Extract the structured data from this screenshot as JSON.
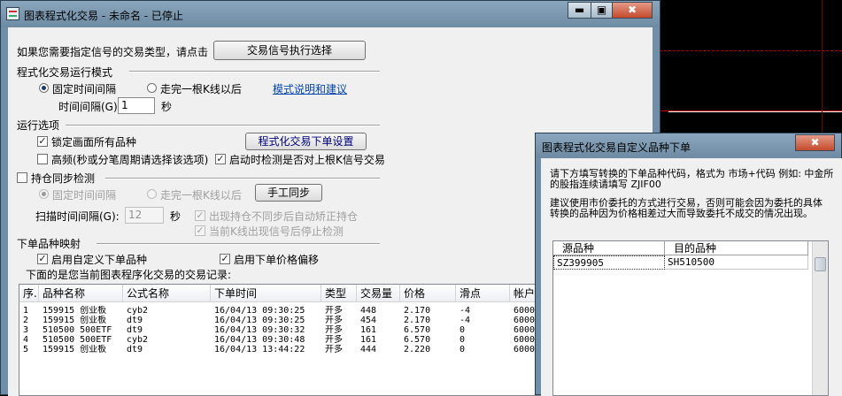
{
  "colors": {
    "title_bg": "#7591a9",
    "accent_red": "#c00000",
    "link": "#0645ad"
  },
  "main": {
    "title": "图表程式化交易 - 未命名 - 已停止",
    "title_buttons": [
      "▬",
      "▣",
      "✖"
    ],
    "signal_prompt": "如果您需要指定信号的交易类型，请点击",
    "signal_button": "交易信号执行选择",
    "mode_group": "程式化交易运行模式",
    "radio_fixed": "固定时间间隔",
    "radio_kline": "走完一根K线以后",
    "mode_link": "模式说明和建议",
    "interval_label": "时间间隔(G):",
    "interval_value": "1",
    "interval_unit": "秒",
    "options_group": "运行选项",
    "lock_all": "锁定画面所有品种",
    "order_settings_button": "程式化交易下单设置",
    "high_freq": "高频(秒或分笔周期请选择该选项)",
    "startup_check": "启动时检测是否对上根K信号交易",
    "sync_group": "持仓同步检测",
    "sync_fixed": "固定时间间隔",
    "sync_kline": "走完一根K线以后",
    "manual_sync_button": "手工同步",
    "scan_label": "扫描时间间隔(G):",
    "scan_value": "12",
    "scan_unit": "秒",
    "auto_fix": "出现持仓不同步后自动矫正持仓",
    "stop_on_signal": "当前K线出现信号后停止检测",
    "map_group": "下单品种映射",
    "custom_symbol": "启用自定义下单品种",
    "price_offset": "启用下单价格偏移",
    "records_caption": "下面的是您当前图表程序化交易的交易记录:",
    "columns": [
      "序.",
      "品种名称",
      "公式名称",
      "下单时间",
      "类型",
      "交易量",
      "价格",
      "滑点",
      "帐户"
    ],
    "rows": [
      [
        "1",
        "159915 创业板",
        "cyb2",
        "16/04/13 09:30:25",
        "开多",
        "448",
        "2.170",
        "-4",
        "6000"
      ],
      [
        "2",
        "159915 创业板",
        "dt9",
        "16/04/13 09:30:25",
        "开多",
        "454",
        "2.170",
        "-4",
        "6000"
      ],
      [
        "3",
        "510500 500ETF",
        "dt9",
        "16/04/13 09:30:32",
        "开多",
        "161",
        "6.570",
        "0",
        "6000"
      ],
      [
        "4",
        "510500 500ETF",
        "cyb2",
        "16/04/13 09:30:48",
        "开多",
        "161",
        "6.570",
        "0",
        "6000"
      ],
      [
        "5",
        "159915 创业板",
        "dt9",
        "16/04/13 13:44:22",
        "开多",
        "444",
        "2.220",
        "0",
        "6000"
      ]
    ]
  },
  "dialog": {
    "title": "图表程式化交易自定义品种下单",
    "close": "✖",
    "desc1": "请下方填写转换的下单品种代码，格式为 市场+代码 例如: 中金所的股指连续请填写 ZJIF00",
    "desc2": "建议使用市价委托的方式进行交易，否则可能会因为委托的具体转换的品种因为价格相差过大而导致委托不成交的情况出现。",
    "columns": [
      "源品种",
      "目的品种"
    ],
    "rows": [
      [
        "SZ399905",
        "SH510500"
      ]
    ]
  }
}
